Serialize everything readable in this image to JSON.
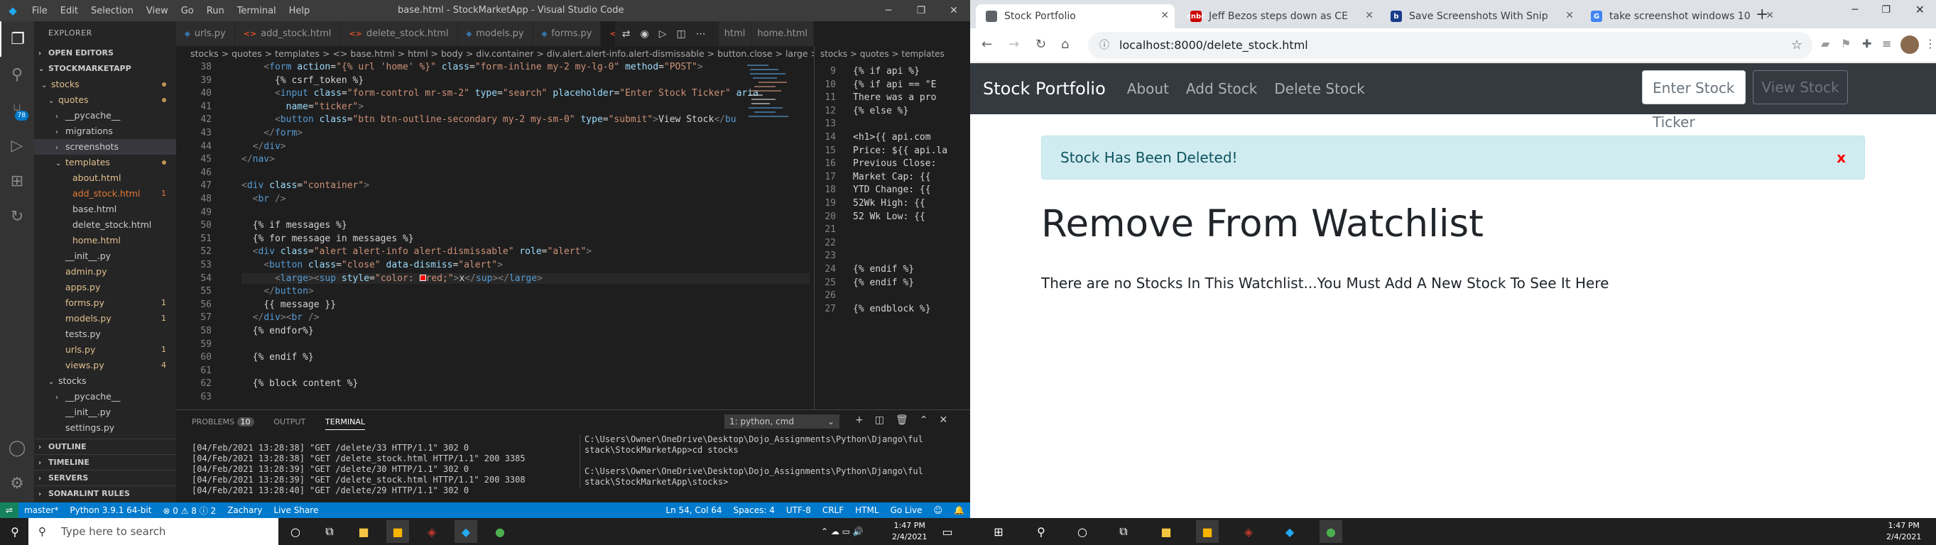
{
  "vscode": {
    "menu": [
      "File",
      "Edit",
      "Selection",
      "View",
      "Go",
      "Run",
      "Terminal",
      "Help"
    ],
    "title": "base.html - StockMarketApp - Visual Studio Code",
    "explorer_header": "EXPLORER",
    "open_editors": "OPEN EDITORS",
    "project": "STOCKMARKETAPP",
    "tree": [
      {
        "label": "stocks",
        "indent": 1,
        "chev": "v",
        "cls": "c-mod",
        "dot": true
      },
      {
        "label": "quotes",
        "indent": 2,
        "chev": "v",
        "cls": "c-mod",
        "dot": true
      },
      {
        "label": "__pycache__",
        "indent": 3,
        "chev": ">",
        "cls": "c-folder"
      },
      {
        "label": "migrations",
        "indent": 3,
        "chev": ">",
        "cls": "c-folder"
      },
      {
        "label": "screenshots",
        "indent": 3,
        "chev": ">",
        "cls": "c-folder",
        "sel": true
      },
      {
        "label": "templates",
        "indent": 3,
        "chev": "v",
        "cls": "c-mod",
        "dot": true
      },
      {
        "label": "about.html",
        "indent": 4,
        "cls": "c-mod"
      },
      {
        "label": "add_stock.html",
        "indent": 4,
        "cls": "c-err",
        "num": "1"
      },
      {
        "label": "base.html",
        "indent": 4,
        "cls": "c-folder"
      },
      {
        "label": "delete_stock.html",
        "indent": 4,
        "cls": "c-folder"
      },
      {
        "label": "home.html",
        "indent": 4,
        "cls": "c-mod"
      },
      {
        "label": "__init__.py",
        "indent": 3,
        "cls": "c-folder"
      },
      {
        "label": "admin.py",
        "indent": 3,
        "cls": "c-mod"
      },
      {
        "label": "apps.py",
        "indent": 3,
        "cls": "c-mod"
      },
      {
        "label": "forms.py",
        "indent": 3,
        "cls": "c-mod",
        "num": "1"
      },
      {
        "label": "models.py",
        "indent": 3,
        "cls": "c-mod",
        "num": "1"
      },
      {
        "label": "tests.py",
        "indent": 3,
        "cls": "c-folder"
      },
      {
        "label": "urls.py",
        "indent": 3,
        "cls": "c-mod",
        "num": "1"
      },
      {
        "label": "views.py",
        "indent": 3,
        "cls": "c-mod",
        "num": "4"
      },
      {
        "label": "stocks",
        "indent": 2,
        "chev": "v",
        "cls": "c-folder"
      },
      {
        "label": "__pycache__",
        "indent": 3,
        "chev": ">",
        "cls": "c-folder"
      },
      {
        "label": "__init__.py",
        "indent": 3,
        "cls": "c-folder"
      },
      {
        "label": "settings.py",
        "indent": 3,
        "cls": "c-folder"
      }
    ],
    "outline": [
      "OUTLINE",
      "TIMELINE",
      "SERVERS",
      "SONARLINT RULES"
    ],
    "tabs": [
      {
        "label": "urls.py",
        "icon": "py"
      },
      {
        "label": "add_stock.html",
        "icon": "<>"
      },
      {
        "label": "delete_stock.html",
        "icon": "<>"
      },
      {
        "label": "models.py",
        "icon": "py"
      },
      {
        "label": "forms.py",
        "icon": "py"
      },
      {
        "label": "base.html",
        "icon": "<>",
        "active": true
      }
    ],
    "right_tabs": [
      "html",
      "home.html"
    ],
    "breadcrumb": "stocks > quotes > templates > <> base.html > html > body > div.container > div.alert.alert-info.alert-dismissable > button.close > large > sup",
    "breadcrumb2": "stocks > quotes > templates",
    "code_lines": [
      {
        "n": "38",
        "html": "    <span class='t-br'>&lt;</span><span class='t-tag'>form</span> <span class='t-attr'>action</span>=<span class='t-str'>\"{% url 'home' %}\"</span> <span class='t-attr'>class</span>=<span class='t-str'>\"form-inline my-2 my-lg-0\"</span> <span class='t-attr'>method</span>=<span class='t-str'>\"POST\"</span><span class='t-br'>&gt;</span>"
      },
      {
        "n": "39",
        "html": "      {% csrf_token %}"
      },
      {
        "n": "40",
        "html": "      <span class='t-br'>&lt;</span><span class='t-tag'>input</span> <span class='t-attr'>class</span>=<span class='t-str'>\"form-control mr-sm-2\"</span> <span class='t-attr'>type</span>=<span class='t-str'>\"search\"</span> <span class='t-attr'>placeholder</span>=<span class='t-str'>\"Enter Stock Ticker\"</span> <span class='t-attr'>aria</span>"
      },
      {
        "n": "41",
        "html": "        <span class='t-attr'>name</span>=<span class='t-str'>\"ticker\"</span><span class='t-br'>&gt;</span>"
      },
      {
        "n": "42",
        "html": "      <span class='t-br'>&lt;</span><span class='t-tag'>button</span> <span class='t-attr'>class</span>=<span class='t-str'>\"btn btn-outline-secondary my-2 my-sm-0\"</span> <span class='t-attr'>type</span>=<span class='t-str'>\"submit\"</span><span class='t-br'>&gt;</span>View Stock<span class='t-br'>&lt;/</span><span class='t-tag'>bu</span>"
      },
      {
        "n": "43",
        "html": "    <span class='t-br'>&lt;/</span><span class='t-tag'>form</span><span class='t-br'>&gt;</span>"
      },
      {
        "n": "44",
        "html": "  <span class='t-br'>&lt;/</span><span class='t-tag'>div</span><span class='t-br'>&gt;</span>"
      },
      {
        "n": "45",
        "html": "<span class='t-br'>&lt;/</span><span class='t-tag'>nav</span><span class='t-br'>&gt;</span>"
      },
      {
        "n": "46",
        "html": ""
      },
      {
        "n": "47",
        "html": "<span class='t-br'>&lt;</span><span class='t-tag'>div</span> <span class='t-attr'>class</span>=<span class='t-str'>\"container\"</span><span class='t-br'>&gt;</span>"
      },
      {
        "n": "48",
        "html": "  <span class='t-br'>&lt;</span><span class='t-tag'>br</span> <span class='t-br'>/&gt;</span>"
      },
      {
        "n": "49",
        "html": ""
      },
      {
        "n": "50",
        "html": "  {% if messages %}"
      },
      {
        "n": "51",
        "html": "  {% for message in messages %}"
      },
      {
        "n": "52",
        "html": "  <span class='t-br'>&lt;</span><span class='t-tag'>div</span> <span class='t-attr'>class</span>=<span class='t-str'>\"alert alert-info alert-dismissable\"</span> <span class='t-attr'>role</span>=<span class='t-str'>\"alert\"</span><span class='t-br'>&gt;</span>"
      },
      {
        "n": "53",
        "html": "    <span class='t-br'>&lt;</span><span class='t-tag'>button</span> <span class='t-attr'>class</span>=<span class='t-str'>\"close\"</span> <span class='t-attr'>data-dismiss</span>=<span class='t-str'>\"alert\"</span><span class='t-br'>&gt;</span>"
      },
      {
        "n": "54",
        "html": "      <span class='t-br'>&lt;</span><span class='t-tag'>large</span><span class='t-br'>&gt;&lt;</span><span class='t-tag'>sup</span> <span class='t-attr'>style</span>=<span class='t-str'>\"color: <span style='display:inline-block;width:9px;height:9px;background:red;border:1px solid #fff'></span>red;\"</span><span class='t-br'>&gt;</span>x<span class='t-br'>&lt;/</span><span class='t-tag'>sup</span><span class='t-br'>&gt;&lt;/</span><span class='t-tag'>large</span><span class='t-br'>&gt;</span>",
        "cur": true
      },
      {
        "n": "55",
        "html": "    <span class='t-br'>&lt;/</span><span class='t-tag'>button</span><span class='t-br'>&gt;</span>"
      },
      {
        "n": "56",
        "html": "    {{ message }}"
      },
      {
        "n": "57",
        "html": "  <span class='t-br'>&lt;/</span><span class='t-tag'>div</span><span class='t-br'>&gt;&lt;</span><span class='t-tag'>br</span> <span class='t-br'>/&gt;</span>"
      },
      {
        "n": "58",
        "html": "  {% endfor%}"
      },
      {
        "n": "59",
        "html": ""
      },
      {
        "n": "60",
        "html": "  {% endif %}"
      },
      {
        "n": "61",
        "html": ""
      },
      {
        "n": "62",
        "html": "  {% block content %}"
      },
      {
        "n": "63",
        "html": ""
      }
    ],
    "code2_lines": [
      {
        "n": "9",
        "t": "{% if api %}"
      },
      {
        "n": "10",
        "t": "{% if api == \"E"
      },
      {
        "n": "11",
        "t": "There was a pro"
      },
      {
        "n": "12",
        "t": "{% else %}"
      },
      {
        "n": "13",
        "t": ""
      },
      {
        "n": "14",
        "t": "<h1>{{ api.com"
      },
      {
        "n": "15",
        "t": "Price: ${{ api.la"
      },
      {
        "n": "16",
        "t": "Previous Close:"
      },
      {
        "n": "17",
        "t": "Market Cap: {{"
      },
      {
        "n": "18",
        "t": "YTD Change: {{"
      },
      {
        "n": "19",
        "t": "52Wk High: {{"
      },
      {
        "n": "20",
        "t": "52 Wk Low: {{"
      },
      {
        "n": "21",
        "t": ""
      },
      {
        "n": "22",
        "t": ""
      },
      {
        "n": "23",
        "t": ""
      },
      {
        "n": "24",
        "t": "{% endif %}"
      },
      {
        "n": "25",
        "t": "{% endif %}"
      },
      {
        "n": "26",
        "t": ""
      },
      {
        "n": "27",
        "t": "{% endblock %}"
      }
    ],
    "panel_tabs": {
      "problems": "PROBLEMS",
      "problems_count": "10",
      "output": "OUTPUT",
      "terminal": "TERMINAL"
    },
    "terminal_select": "1: python, cmd",
    "terminal_left": [
      "[04/Feb/2021 13:28:38] \"GET /delete/33 HTTP/1.1\" 302 0",
      "[04/Feb/2021 13:28:38] \"GET /delete_stock.html HTTP/1.1\" 200 3385",
      "[04/Feb/2021 13:28:39] \"GET /delete/30 HTTP/1.1\" 302 0",
      "[04/Feb/2021 13:28:39] \"GET /delete_stock.html HTTP/1.1\" 200 3308",
      "[04/Feb/2021 13:28:40] \"GET /delete/29 HTTP/1.1\" 302 0"
    ],
    "terminal_right": [
      "C:\\Users\\Owner\\OneDrive\\Desktop\\Dojo_Assignments\\Python\\Django\\ful",
      "stack\\StockMarketApp>cd stocks",
      "",
      "C:\\Users\\Owner\\OneDrive\\Desktop\\Dojo_Assignments\\Python\\Django\\ful",
      "stack\\StockMarketApp\\stocks>"
    ],
    "status": {
      "branch": "master*",
      "python": "Python 3.9.1 64-bit",
      "errors": "⊗ 0 ⚠ 8 ⓘ 2",
      "user": "Zachary",
      "liveshare": "Live Share",
      "position": "Ln 54, Col 64",
      "spaces": "Spaces: 4",
      "encoding": "UTF-8",
      "eol": "CRLF",
      "lang": "HTML",
      "golive": "Go Live"
    }
  },
  "taskbar_left": {
    "search_placeholder": "Type here to search",
    "time": "1:47 PM",
    "date": "2/4/2021"
  },
  "taskbar_right": {
    "time": "1:47 PM",
    "date": "2/4/2021"
  },
  "chrome": {
    "tabs": [
      {
        "label": "Stock Portfolio",
        "fav": "#5f6368",
        "active": true
      },
      {
        "label": "Jeff Bezos steps down as CE",
        "fav": "#cc0000",
        "favtext": "cnbc"
      },
      {
        "label": "Save Screenshots With Snip",
        "fav": "#1a3c8c",
        "favtext": "b"
      },
      {
        "label": "take screenshot windows 10",
        "fav": "#4285f4",
        "favtext": "G"
      }
    ],
    "url": "localhost:8000/delete_stock.html"
  },
  "page": {
    "brand": "Stock Portfolio",
    "nav": [
      "About",
      "Add Stock",
      "Delete Stock"
    ],
    "ticker_placeholder": "Enter Stock Ticker",
    "view_button": "View Stock",
    "alert": "Stock Has Been Deleted!",
    "alert_close": "x",
    "heading": "Remove From Watchlist",
    "empty_message": "There are no Stocks In This Watchlist...You Must Add A New Stock To See It Here"
  }
}
